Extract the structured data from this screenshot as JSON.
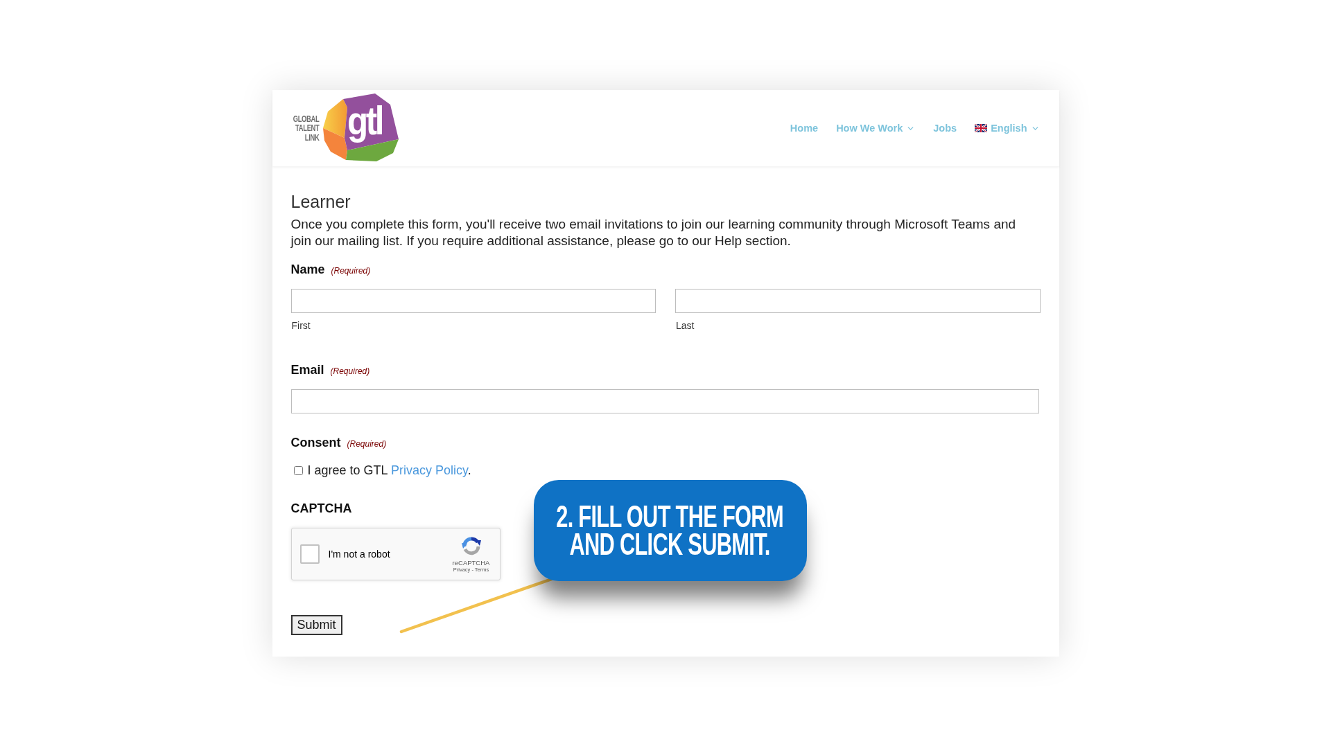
{
  "header": {
    "logo": {
      "wordmark": [
        "GLOBAL",
        "TALENT",
        "LINK"
      ],
      "monogram": "gtl"
    },
    "nav": [
      {
        "label": "Home",
        "kind": "link"
      },
      {
        "label": "How We Work",
        "kind": "dropdown"
      },
      {
        "label": "Jobs",
        "kind": "link"
      },
      {
        "label": "English",
        "kind": "language"
      }
    ]
  },
  "form": {
    "title": "Learner",
    "description": "Once you complete this form, you'll receive two email invitations to join our learning community through Microsoft Teams and join our mailing list. If you require additional assistance, please go to our Help section.",
    "fields": [
      {
        "kind": "name",
        "label": "Name",
        "required": "(Required)",
        "parts": [
          "First",
          "Last"
        ]
      },
      {
        "kind": "email",
        "label": "Email",
        "required": "(Required)"
      },
      {
        "kind": "consent",
        "label": "Consent",
        "required": "(Required)",
        "checked": false,
        "text": "I agree to GTL",
        "link": "Privacy Policy",
        "after": "."
      },
      {
        "kind": "captcha",
        "label": "CAPTCHA",
        "checked": false,
        "prompt": "I'm not a robot",
        "brand": "reCAPTCHA",
        "links": "Privacy - Terms"
      }
    ],
    "submit": "Submit"
  },
  "callout": {
    "lines": [
      "2. FILL OUT THE FORM",
      "AND CLICK SUBMIT."
    ]
  }
}
